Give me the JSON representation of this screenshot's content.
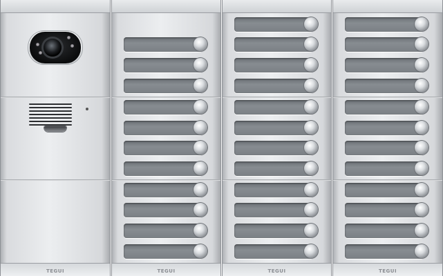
{
  "brand_text": "TEGUI",
  "panel": {
    "columns": [
      {
        "type": "camera-speaker",
        "brand": "TEGUI"
      },
      {
        "type": "buttons",
        "brand": "TEGUI",
        "button_count": 11
      },
      {
        "type": "buttons",
        "brand": "TEGUI",
        "button_count": 12
      },
      {
        "type": "buttons",
        "brand": "TEGUI",
        "button_count": 12
      }
    ]
  },
  "colors": {
    "aluminium": "#dfe1e4",
    "name_plate": "#7d8287",
    "camera": "#0c0d0e"
  }
}
